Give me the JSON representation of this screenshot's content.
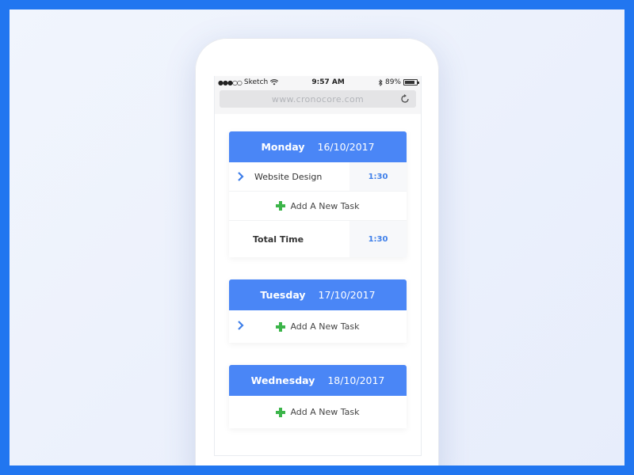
{
  "status_bar": {
    "carrier": "Sketch",
    "time": "9:57 AM",
    "battery": "89%",
    "battery_level": 0.89
  },
  "browser": {
    "url": "www.cronocore.com"
  },
  "days": [
    {
      "day": "Monday",
      "date": "16/10/2017",
      "tasks": [
        {
          "name": "Website Design",
          "time": "1:30"
        }
      ],
      "add_label": "Add A New Task",
      "total_label": "Total Time",
      "total_time": "1:30"
    },
    {
      "day": "Tuesday",
      "date": "17/10/2017",
      "add_label": "Add A New Task"
    },
    {
      "day": "Wednesday",
      "date": "18/10/2017",
      "add_label": "Add A New Task"
    }
  ],
  "colors": {
    "accent": "#4a86f6",
    "plus_green": "#3cb54a",
    "frame_blue": "#2176f0"
  }
}
